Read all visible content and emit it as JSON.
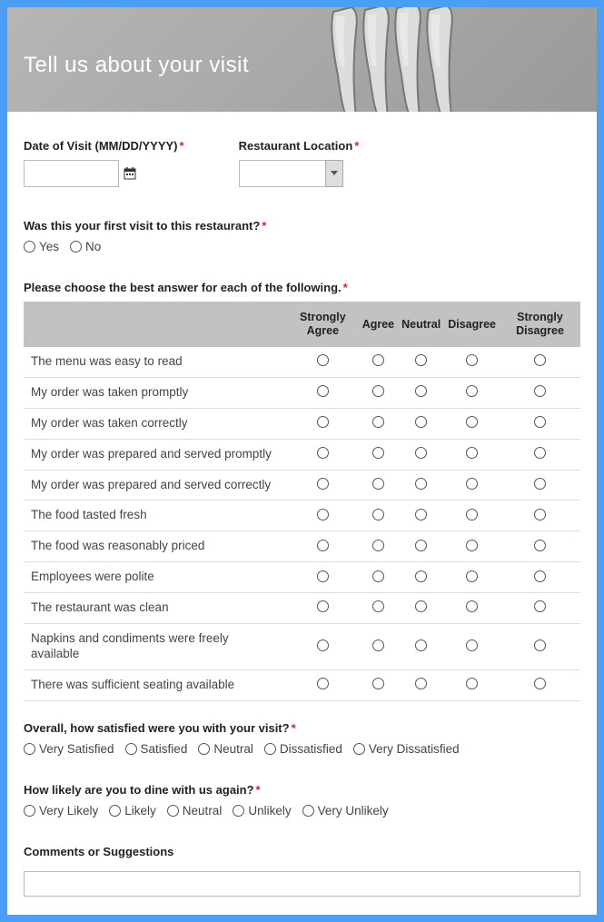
{
  "header": {
    "title": "Tell us about your visit"
  },
  "fields": {
    "date_label": "Date of Visit (MM/DD/YYYY)",
    "location_label": "Restaurant Location",
    "first_visit_label": "Was this your first visit to this restaurant?",
    "yes": "Yes",
    "no": "No",
    "matrix_label": "Please choose the best answer for each of the following.",
    "overall_label": "Overall, how satisfied were you with your visit?",
    "likely_label": "How likely are you to dine with us again?",
    "comments_label": "Comments or Suggestions",
    "req": "*"
  },
  "matrix": {
    "columns": [
      "Strongly Agree",
      "Agree",
      "Neutral",
      "Disagree",
      "Strongly Disagree"
    ],
    "rows": [
      "The menu was easy to read",
      "My order was taken promptly",
      "My order was taken correctly",
      "My order was prepared and served promptly",
      "My order was prepared and served correctly",
      "The food tasted fresh",
      "The food was reasonably priced",
      "Employees were polite",
      "The restaurant was clean",
      "Napkins and condiments were freely available",
      "There was sufficient seating available"
    ]
  },
  "overall_options": [
    "Very Satisfied",
    "Satisfied",
    "Neutral",
    "Dissatisfied",
    "Very Dissatisfied"
  ],
  "likely_options": [
    "Very Likely",
    "Likely",
    "Neutral",
    "Unlikely",
    "Very Unlikely"
  ]
}
